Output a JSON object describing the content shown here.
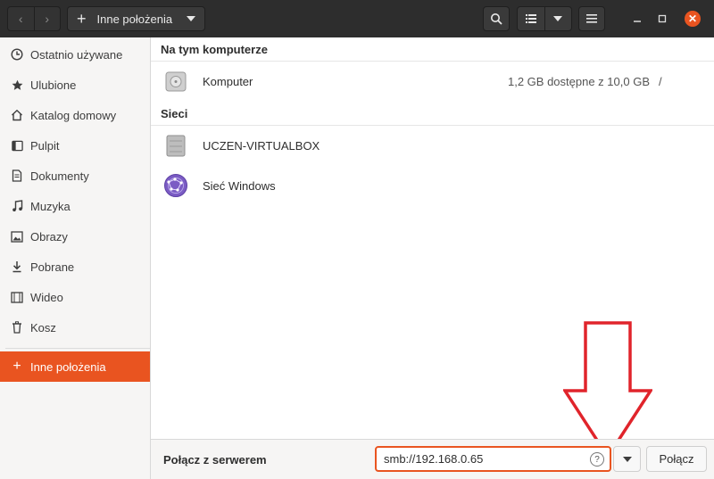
{
  "header": {
    "path_label": "Inne położenia"
  },
  "sidebar": {
    "items": [
      {
        "label": "Ostatnio używane",
        "icon": "clock-icon"
      },
      {
        "label": "Ulubione",
        "icon": "star-icon"
      },
      {
        "label": "Katalog domowy",
        "icon": "home-icon"
      },
      {
        "label": "Pulpit",
        "icon": "desktop-icon"
      },
      {
        "label": "Dokumenty",
        "icon": "document-icon"
      },
      {
        "label": "Muzyka",
        "icon": "music-icon"
      },
      {
        "label": "Obrazy",
        "icon": "image-icon"
      },
      {
        "label": "Pobrane",
        "icon": "download-icon"
      },
      {
        "label": "Wideo",
        "icon": "video-icon"
      },
      {
        "label": "Kosz",
        "icon": "trash-icon"
      }
    ],
    "other_locations": "Inne położenia"
  },
  "main": {
    "section_computer": "Na tym komputerze",
    "computer": {
      "name": "Komputer",
      "info": "1,2 GB dostępne z 10,0 GB",
      "path": "/"
    },
    "section_networks": "Sieci",
    "networks": [
      {
        "name": "UCZEN-VIRTUALBOX",
        "icon": "server-icon"
      },
      {
        "name": "Sieć Windows",
        "icon": "network-globe-icon"
      }
    ]
  },
  "bottom": {
    "connect_label": "Połącz z serwerem",
    "address_value": "smb://192.168.0.65",
    "connect_button": "Połącz"
  },
  "colors": {
    "accent": "#e95420",
    "header_bg": "#2d2d2d",
    "annotation_arrow": "#e0242b"
  }
}
